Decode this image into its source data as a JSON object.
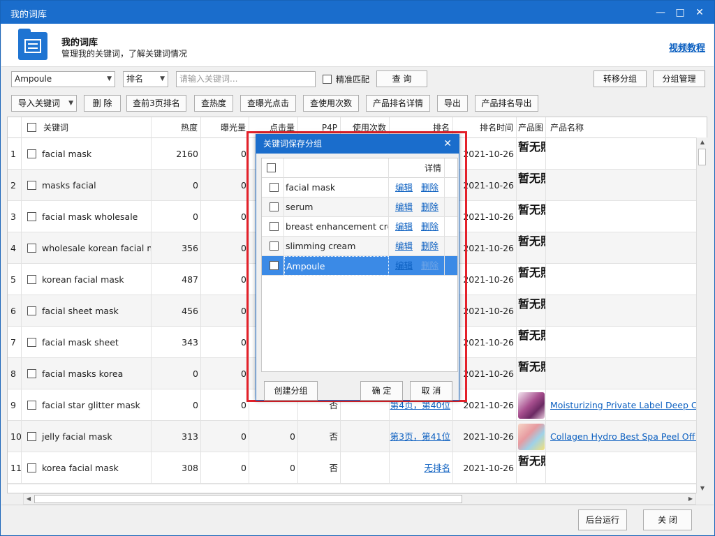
{
  "window": {
    "title": "我的词库",
    "minimize": "—",
    "maximize": "□",
    "close": "✕"
  },
  "header": {
    "title": "我的词库",
    "subtitle": "管理我的关键词，了解关键词情况",
    "video_link": "视频教程"
  },
  "toolbar": {
    "group_select": "Ampoule",
    "sort_select": "排名",
    "keyword_placeholder": "请输入关键词...",
    "exact_match": "精准匹配",
    "query": "查 询",
    "move_group": "转移分组",
    "group_manage": "分组管理",
    "import": "导入关键词",
    "delete": "删 除",
    "top3_rank": "查前3页排名",
    "heat": "查热度",
    "exposure_click": "查曝光点击",
    "use_count": "查使用次数",
    "product_rank_detail": "产品排名详情",
    "export": "导出",
    "product_rank_export": "产品排名导出"
  },
  "grid": {
    "columns": [
      "关键词",
      "热度",
      "曝光量",
      "点击量",
      "P4P",
      "使用次数",
      "排名",
      "排名时间",
      "产品图",
      "产品名称"
    ],
    "no_image": "暂无照片",
    "rows": [
      {
        "n": "1",
        "kw": "facial mask",
        "heat": "2160",
        "exp": "0",
        "click": "",
        "p4p": "",
        "use": "",
        "rank": "",
        "time": "2021-10-26",
        "img": "none",
        "name": ""
      },
      {
        "n": "2",
        "kw": "masks facial",
        "heat": "0",
        "exp": "0",
        "click": "",
        "p4p": "",
        "use": "",
        "rank": "",
        "time": "2021-10-26",
        "img": "none",
        "name": ""
      },
      {
        "n": "3",
        "kw": "facial mask wholesale",
        "heat": "0",
        "exp": "0",
        "click": "",
        "p4p": "",
        "use": "",
        "rank": "",
        "time": "2021-10-26",
        "img": "none",
        "name": ""
      },
      {
        "n": "4",
        "kw": "wholesale korean facial ma",
        "heat": "356",
        "exp": "0",
        "click": "",
        "p4p": "",
        "use": "",
        "rank": "",
        "time": "2021-10-26",
        "img": "none",
        "name": ""
      },
      {
        "n": "5",
        "kw": "korean facial mask",
        "heat": "487",
        "exp": "0",
        "click": "",
        "p4p": "",
        "use": "",
        "rank": "",
        "time": "2021-10-26",
        "img": "none",
        "name": ""
      },
      {
        "n": "6",
        "kw": "facial sheet mask",
        "heat": "456",
        "exp": "0",
        "click": "",
        "p4p": "",
        "use": "",
        "rank": "",
        "time": "2021-10-26",
        "img": "none",
        "name": ""
      },
      {
        "n": "7",
        "kw": "facial mask sheet",
        "heat": "343",
        "exp": "0",
        "click": "",
        "p4p": "",
        "use": "",
        "rank": "",
        "time": "2021-10-26",
        "img": "none",
        "name": ""
      },
      {
        "n": "8",
        "kw": "facial masks korea",
        "heat": "0",
        "exp": "0",
        "click": "",
        "p4p": "",
        "use": "",
        "rank": "",
        "time": "2021-10-26",
        "img": "none",
        "name": ""
      },
      {
        "n": "9",
        "kw": "facial star glitter mask",
        "heat": "0",
        "exp": "0",
        "click": "",
        "p4p": "否",
        "use": "",
        "rank": "第4页，第40位",
        "time": "2021-10-26",
        "img": "purple-jar",
        "name": "Moisturizing Private Label Deep Clea"
      },
      {
        "n": "10",
        "kw": "jelly facial mask",
        "heat": "313",
        "exp": "0",
        "click": "0",
        "p4p": "否",
        "use": "",
        "rank": "第3页，第41位",
        "time": "2021-10-26",
        "img": "face-mask",
        "name": "Collagen Hydro Best Spa Peel Off Ro"
      },
      {
        "n": "11",
        "kw": "korea facial mask",
        "heat": "308",
        "exp": "0",
        "click": "0",
        "p4p": "否",
        "use": "",
        "rank": "无排名",
        "time": "2021-10-26",
        "img": "none",
        "name": ""
      }
    ]
  },
  "dialog": {
    "title": "关键词保存分组",
    "close": "✕",
    "detail_header": "详情",
    "edit": "编辑",
    "delete": "删除",
    "groups": [
      "facial mask",
      "serum",
      "breast enhancement crea",
      "slimming cream",
      "Ampoule"
    ],
    "selected_index": 4,
    "create_group": "创建分组",
    "ok": "确 定",
    "cancel": "取 消"
  },
  "bottom": {
    "background_run": "后台运行",
    "close": "关 闭"
  },
  "colors": {
    "titlebar": "#1a6dcc",
    "link": "#0b5fc0",
    "selected_row": "#3b8ae6",
    "highlight_frame": "#e4212a"
  }
}
